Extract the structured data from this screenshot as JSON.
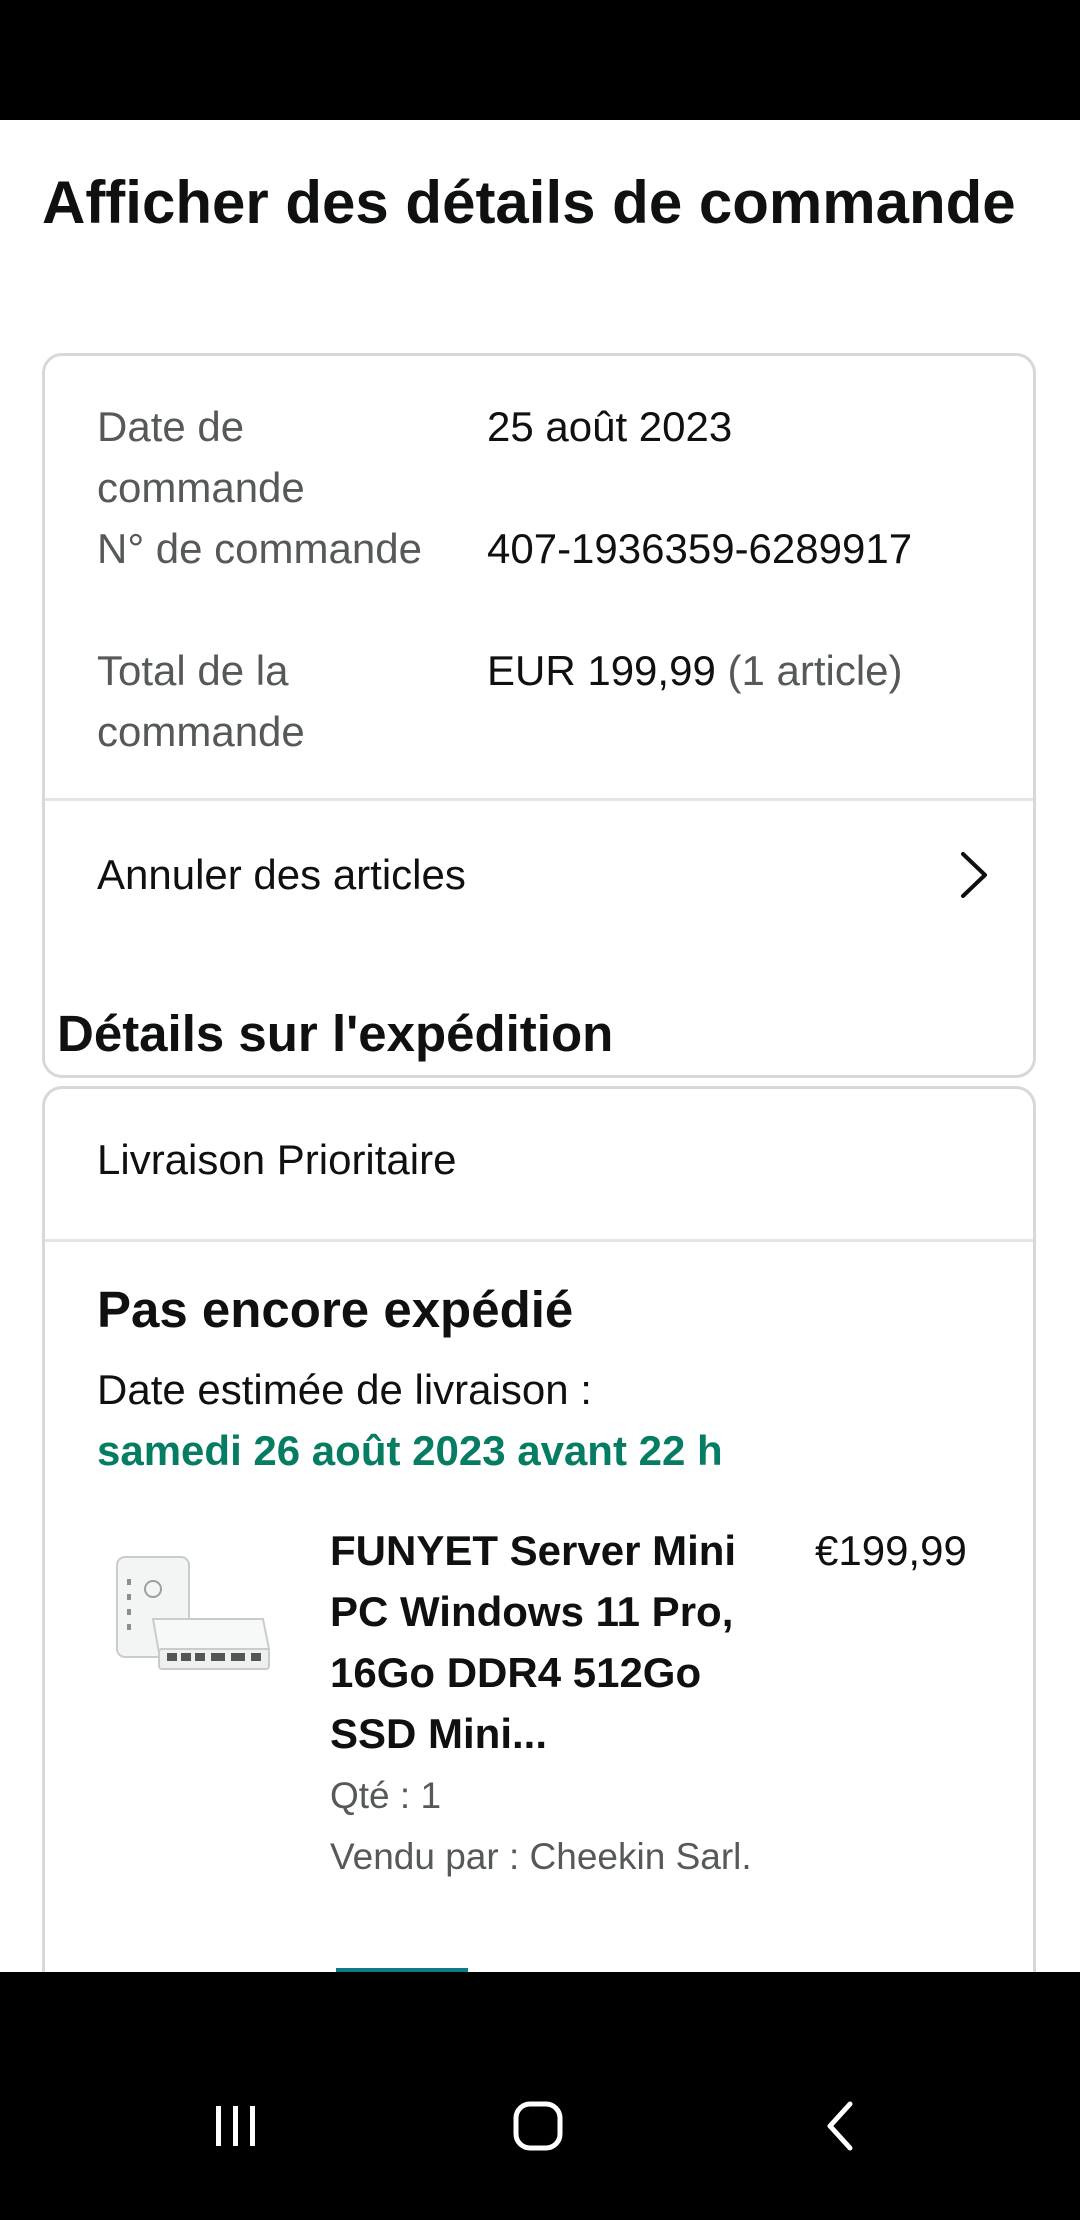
{
  "page": {
    "title": "Afficher des détails de commande"
  },
  "order_summary": {
    "rows": [
      {
        "label": "Date de commande",
        "value": "25 août 2023"
      },
      {
        "label": "N° de commande",
        "value": "407-1936359-6289917"
      },
      {
        "label": "Total de la commande",
        "value": "EUR 199,99",
        "value_note": "(1 article)"
      }
    ],
    "cancel_label": "Annuler des articles",
    "cancel_icon": "chevron-right-icon"
  },
  "shipment": {
    "section_title": "Détails sur l'expédition",
    "method": "Livraison Prioritaire",
    "status": "Pas encore expédié",
    "eta_label": "Date estimée de livraison :",
    "eta_value": "samedi 26 août 2023 avant 22 h",
    "eta_color": "#067d62",
    "item": {
      "title": "FUNYET Server Mini PC Windows 11 Pro, 16Go DDR4 512Go SSD Mini...",
      "price": "€199,99",
      "qty": "Qté : 1",
      "seller": "Vendu par : Cheekin Sarl."
    }
  },
  "navigation": {
    "buttons": [
      "recent-apps-icon",
      "home-icon",
      "back-icon"
    ]
  }
}
